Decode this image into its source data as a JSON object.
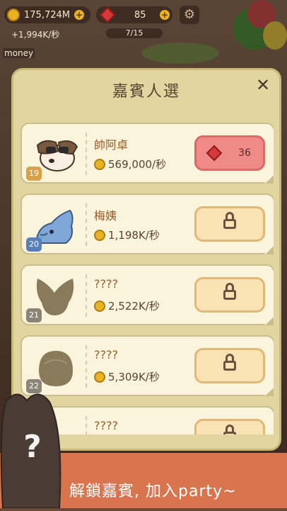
{
  "hud": {
    "coins": "175,724M",
    "gems": "85",
    "rate": "+1,994K/秒",
    "progress": "7/15"
  },
  "side_label": "money",
  "modal": {
    "title": "嘉賓人選",
    "close": "✕"
  },
  "guests": [
    {
      "level": "19",
      "name": "帥阿卓",
      "income": "569,000/秒",
      "action": "gem",
      "cost": "36",
      "level_color": "#d9a24a"
    },
    {
      "level": "20",
      "name": "梅姨",
      "income": "1,198K/秒",
      "action": "lock",
      "level_color": "#5a7fb8"
    },
    {
      "level": "21",
      "name": "????",
      "income": "2,522K/秒",
      "action": "lock",
      "level_color": "#8a8578"
    },
    {
      "level": "22",
      "name": "????",
      "income": "5,309K/秒",
      "action": "lock",
      "level_color": "#8a8578"
    },
    {
      "level": "",
      "name": "????",
      "income": "",
      "action": "lock",
      "level_color": "#8a8578"
    }
  ],
  "banner": {
    "text": "解鎖嘉賓, 加入party~"
  },
  "icons": [
    "coin-icon",
    "gem-icon",
    "gear-icon",
    "lock-icon",
    "close-icon"
  ]
}
